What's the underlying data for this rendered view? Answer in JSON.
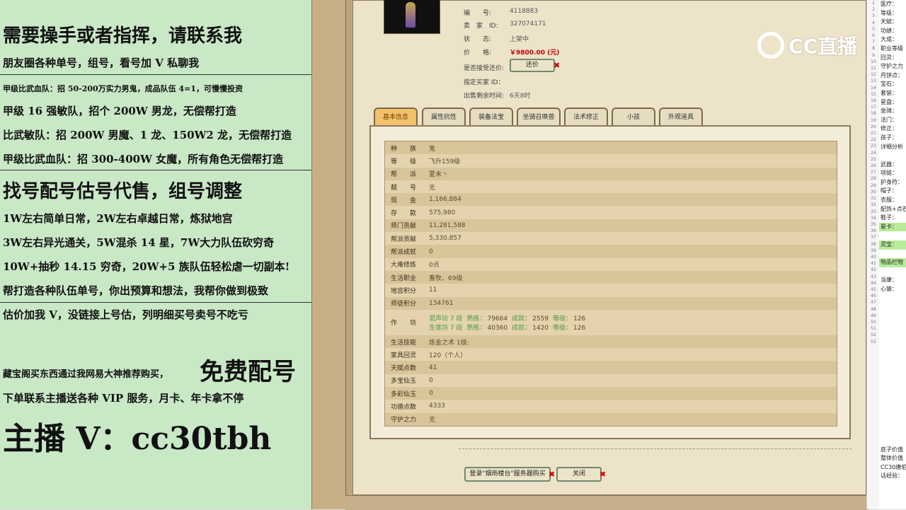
{
  "ad_panel": {
    "line1": "需要操手或者指挥，请联系我",
    "line2": "朋友圈各种单号，组号，看号加 V 私聊我",
    "line3": "甲级比武血队：招 50-200万实力男鬼，成品队伍 4=1，可慢慢投资",
    "line4": "甲级 16 强敏队，招个 200W 男龙，无偿帮打造",
    "line5": "比武敏队：招 200W 男魔、1 龙、150W2 龙，无偿帮打造",
    "line6": "甲级比武血队：招 300-400W 女魔，所有角色无偿帮打造",
    "line7": "找号配号估号代售，组号调整",
    "line8": "1W左右简单日常，2W左右卓越日常，炼狱地宫",
    "line9": "3W左右异光通关，5W混杀 14 星，7W大力队伍砍穷奇",
    "line10": "10W+抽秒 14.15 穷奇，20W+5 族队伍轻松虐一切副本!",
    "line11": "帮打造各种队伍单号，你出预算和想法，我帮你做到极致",
    "line12": "估价加我 V，没链接上号估，列明细买号卖号不吃亏",
    "line13a": "藏宝阁买东西通过我网易大神推荐购买，",
    "line13b": "免费配号",
    "line14": "下单联系主播送各种 VIP 服务，月卡、年卡拿不停",
    "line15": "主播 V：cc30tbh"
  },
  "listing": {
    "id_label": "编　　号:",
    "id_value": "4118883",
    "seller_label": "卖　家　ID:",
    "seller_value": "327074171",
    "status_label": "状　　态:",
    "status_value": "上架中",
    "price_label": "价　　格:",
    "price_value": "￥9800.00 (元)",
    "counter_label": "是否接受还价:",
    "counter_button": "还价",
    "buyer_label": "指定买家 ID：",
    "remain_label": "出售剩余时间:",
    "remain_value": "6天8时"
  },
  "tabs": [
    "基本信息",
    "属性抗性",
    "装备法宝",
    "坐骑召唤兽",
    "法术修正",
    "小孩",
    "外观道具"
  ],
  "rows": [
    {
      "k": "种　　族",
      "v": "鬼",
      "c": "g"
    },
    {
      "k": "等　　级",
      "v": "飞升159级",
      "c": "g"
    },
    {
      "k": "帮　　派",
      "v": "夏末丶",
      "c": "g"
    },
    {
      "k": "靓　　号",
      "v": "无",
      "c": "y"
    },
    {
      "k": "现　　金",
      "v": "1,166,884",
      "c": "y"
    },
    {
      "k": "存　　款",
      "v": "575,980",
      "c": "m"
    },
    {
      "k": "师门贡献",
      "v": "11,281,588",
      "c": ""
    },
    {
      "k": "帮派贡献",
      "v": "5,330,857",
      "c": ""
    },
    {
      "k": "帮派成就",
      "v": "0",
      "c": ""
    },
    {
      "k": "大难修炼",
      "v": "0点",
      "c": ""
    },
    {
      "k": "生活职业",
      "v": "畜牧、69级",
      "c": ""
    },
    {
      "k": "地宫积分",
      "v": "11",
      "c": ""
    },
    {
      "k": "师徒积分",
      "v": "134761",
      "c": ""
    },
    {
      "k": "作　　坊",
      "v": "",
      "c": "tall",
      "lines": [
        {
          "a": "混声坊 7 段",
          "b": "熟练：",
          "c": "79664",
          "d": "成就：",
          "e": "2559",
          "f": "等级：",
          "g": "126"
        },
        {
          "a": "生莲坊 7 段",
          "b": "熟练：",
          "c": "40360",
          "d": "成就：",
          "e": "1420",
          "f": "等级：",
          "g": "126"
        }
      ]
    },
    {
      "k": "生活技能",
      "v": "炼金之术 1级;",
      "c": ""
    },
    {
      "k": "家具回灵",
      "v": "120（个人）",
      "c": ""
    },
    {
      "k": "天赋点数",
      "v": "41",
      "c": ""
    },
    {
      "k": "多宝仙玉",
      "v": "0",
      "c": ""
    },
    {
      "k": "多彩仙玉",
      "v": "0",
      "c": ""
    },
    {
      "k": "功德点数",
      "v": "4333",
      "c": ""
    },
    {
      "k": "守护之力",
      "v": "无",
      "c": "g"
    }
  ],
  "bottom": {
    "login_button": "登录\"烟雨楼台\"服务器购买",
    "close_button": "关闭"
  },
  "logo_text": "CC直播",
  "right_numbers": [
    "1",
    "2",
    "3",
    "4",
    "5",
    "6",
    "7",
    "8",
    "9",
    "10",
    "11",
    "12",
    "13",
    "14",
    "15",
    "16",
    "17",
    "18",
    "19",
    "20",
    "21",
    "22",
    "23",
    "24",
    "25",
    "26",
    "27",
    "28",
    "29",
    "30",
    "31",
    "32",
    "33",
    "34",
    "35",
    "36",
    "37",
    "38",
    "39",
    "40",
    "41",
    "42",
    "43",
    "44",
    "45",
    "46",
    "47",
    "48",
    "49",
    "50",
    "51",
    "52",
    "53"
  ],
  "right_col": [
    {
      "t": "医疗：",
      "hl": false
    },
    {
      "t": "等级：",
      "hl": false
    },
    {
      "t": "天赋：",
      "hl": false
    },
    {
      "t": "功绩：",
      "hl": false
    },
    {
      "t": "大成：",
      "hl": false
    },
    {
      "t": "职业等级",
      "hl": false
    },
    {
      "t": "回灵：",
      "hl": false
    },
    {
      "t": "守护之力",
      "hl": false
    },
    {
      "t": "月饼点：",
      "hl": false
    },
    {
      "t": "宝石：",
      "hl": false
    },
    {
      "t": "套装：",
      "hl": false
    },
    {
      "t": "星盘：",
      "hl": false
    },
    {
      "t": "坐骑：",
      "hl": false
    },
    {
      "t": "法门：",
      "hl": false
    },
    {
      "t": "修正：",
      "hl": false
    },
    {
      "t": "孩子：",
      "hl": false
    },
    {
      "t": "详细分析",
      "hl": false
    },
    {
      "t": "",
      "hl": false
    },
    {
      "t": "武器：",
      "hl": false
    },
    {
      "t": "项链：",
      "hl": false
    },
    {
      "t": "护身符：",
      "hl": false
    },
    {
      "t": "帽子：",
      "hl": false
    },
    {
      "t": "衣服：",
      "hl": false
    },
    {
      "t": "配饰+点石",
      "hl": false
    },
    {
      "t": "鞋子：",
      "hl": false
    },
    {
      "t": "星卡：",
      "hl": true
    },
    {
      "t": "",
      "hl": false
    },
    {
      "t": "灵宝：",
      "hl": true
    },
    {
      "t": "",
      "hl": false
    },
    {
      "t": "物品栏物",
      "hl": true
    },
    {
      "t": "",
      "hl": false
    },
    {
      "t": "当康：",
      "hl": false
    },
    {
      "t": "心猿：",
      "hl": false
    },
    {
      "t": "",
      "hl": false
    },
    {
      "t": "",
      "hl": false
    },
    {
      "t": "",
      "hl": false
    },
    {
      "t": "",
      "hl": false
    },
    {
      "t": "",
      "hl": false
    },
    {
      "t": "",
      "hl": false
    },
    {
      "t": "",
      "hl": false
    },
    {
      "t": "",
      "hl": false
    },
    {
      "t": "",
      "hl": false
    },
    {
      "t": "",
      "hl": false
    },
    {
      "t": "",
      "hl": false
    },
    {
      "t": "",
      "hl": false
    },
    {
      "t": "",
      "hl": false
    },
    {
      "t": "",
      "hl": false
    },
    {
      "t": "",
      "hl": false
    },
    {
      "t": "",
      "hl": false
    },
    {
      "t": "",
      "hl": false
    },
    {
      "t": "底子价值",
      "hl": false
    },
    {
      "t": "整体价值",
      "hl": false
    },
    {
      "t": "CC30唐伯",
      "hl": false
    },
    {
      "t": "话经验：",
      "hl": false
    }
  ]
}
